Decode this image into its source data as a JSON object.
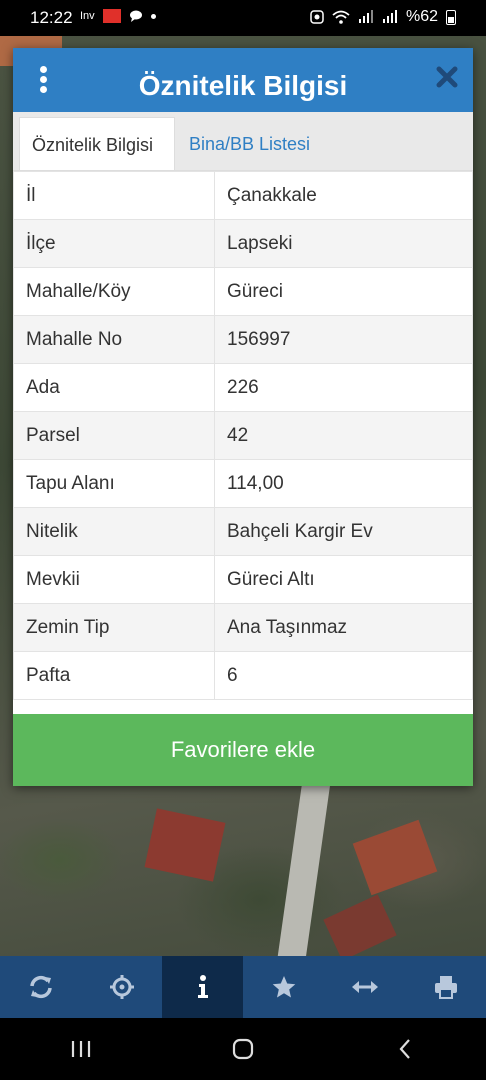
{
  "status_bar": {
    "time": "12:22",
    "app_tag": "Inv",
    "battery_text": "%62"
  },
  "dialog": {
    "title": "Öznitelik Bilgisi",
    "tabs": [
      {
        "label": "Öznitelik Bilgisi",
        "active": true
      },
      {
        "label": "Bina/BB Listesi",
        "active": false
      }
    ],
    "rows": [
      {
        "key": "İl",
        "value": "Çanakkale"
      },
      {
        "key": "İlçe",
        "value": "Lapseki"
      },
      {
        "key": "Mahalle/Köy",
        "value": "Güreci"
      },
      {
        "key": "Mahalle No",
        "value": "156997"
      },
      {
        "key": "Ada",
        "value": "226"
      },
      {
        "key": "Parsel",
        "value": "42"
      },
      {
        "key": "Tapu Alanı",
        "value": "114,00"
      },
      {
        "key": "Nitelik",
        "value": "Bahçeli Kargir Ev"
      },
      {
        "key": "Mevkii",
        "value": "Güreci Altı"
      },
      {
        "key": "Zemin Tip",
        "value": "Ana Taşınmaz"
      },
      {
        "key": "Pafta",
        "value": "6"
      }
    ],
    "favorite_button": "Favorilere ekle"
  },
  "toolbar": {
    "items": [
      {
        "icon": "refresh-icon",
        "active": false
      },
      {
        "icon": "locate-icon",
        "active": false
      },
      {
        "icon": "info-icon",
        "active": true
      },
      {
        "icon": "star-icon",
        "active": false
      },
      {
        "icon": "measure-icon",
        "active": false
      },
      {
        "icon": "print-icon",
        "active": false
      }
    ]
  },
  "navbar": {
    "items": [
      "recent-apps-icon",
      "home-icon",
      "back-icon"
    ]
  },
  "colors": {
    "header": "#2f7fc4",
    "favorite": "#5cb85c",
    "toolbar": "#1f4a7a",
    "toolbar_active": "#0e2a4a"
  }
}
